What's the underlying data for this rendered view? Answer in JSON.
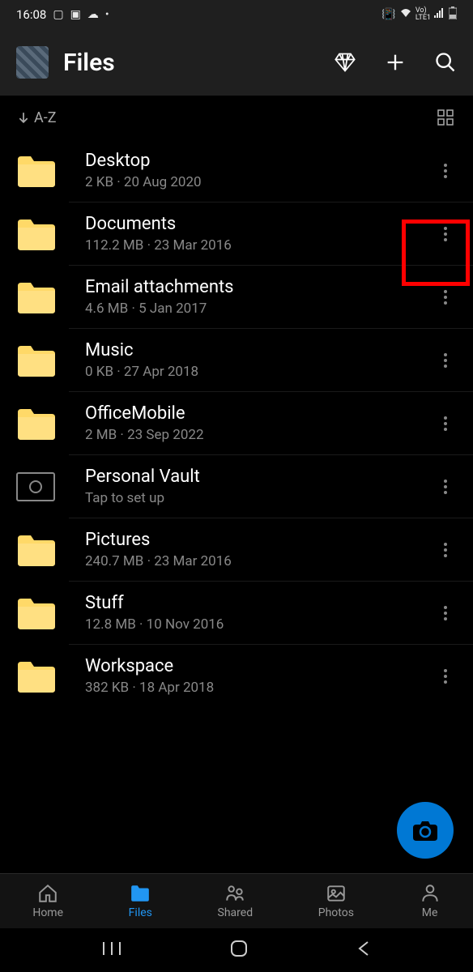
{
  "status": {
    "time": "16:08"
  },
  "header": {
    "title": "Files"
  },
  "sort": {
    "label": "A-Z"
  },
  "files": [
    {
      "name": "Desktop",
      "meta": "2 KB · 20 Aug 2020",
      "type": "folder"
    },
    {
      "name": "Documents",
      "meta": "112.2 MB · 23 Mar 2016",
      "type": "folder"
    },
    {
      "name": "Email attachments",
      "meta": "4.6 MB · 5 Jan 2017",
      "type": "folder"
    },
    {
      "name": "Music",
      "meta": "0 KB · 27 Apr 2018",
      "type": "folder"
    },
    {
      "name": "OfficeMobile",
      "meta": "2 MB · 23 Sep 2022",
      "type": "folder"
    },
    {
      "name": "Personal Vault",
      "meta": "Tap to set up",
      "type": "vault"
    },
    {
      "name": "Pictures",
      "meta": "240.7 MB · 23 Mar 2016",
      "type": "folder"
    },
    {
      "name": "Stuff",
      "meta": "12.8 MB · 10 Nov 2016",
      "type": "folder"
    },
    {
      "name": "Workspace",
      "meta": "382 KB · 18 Apr 2018",
      "type": "folder"
    }
  ],
  "nav": {
    "home": "Home",
    "files": "Files",
    "shared": "Shared",
    "photos": "Photos",
    "me": "Me"
  }
}
